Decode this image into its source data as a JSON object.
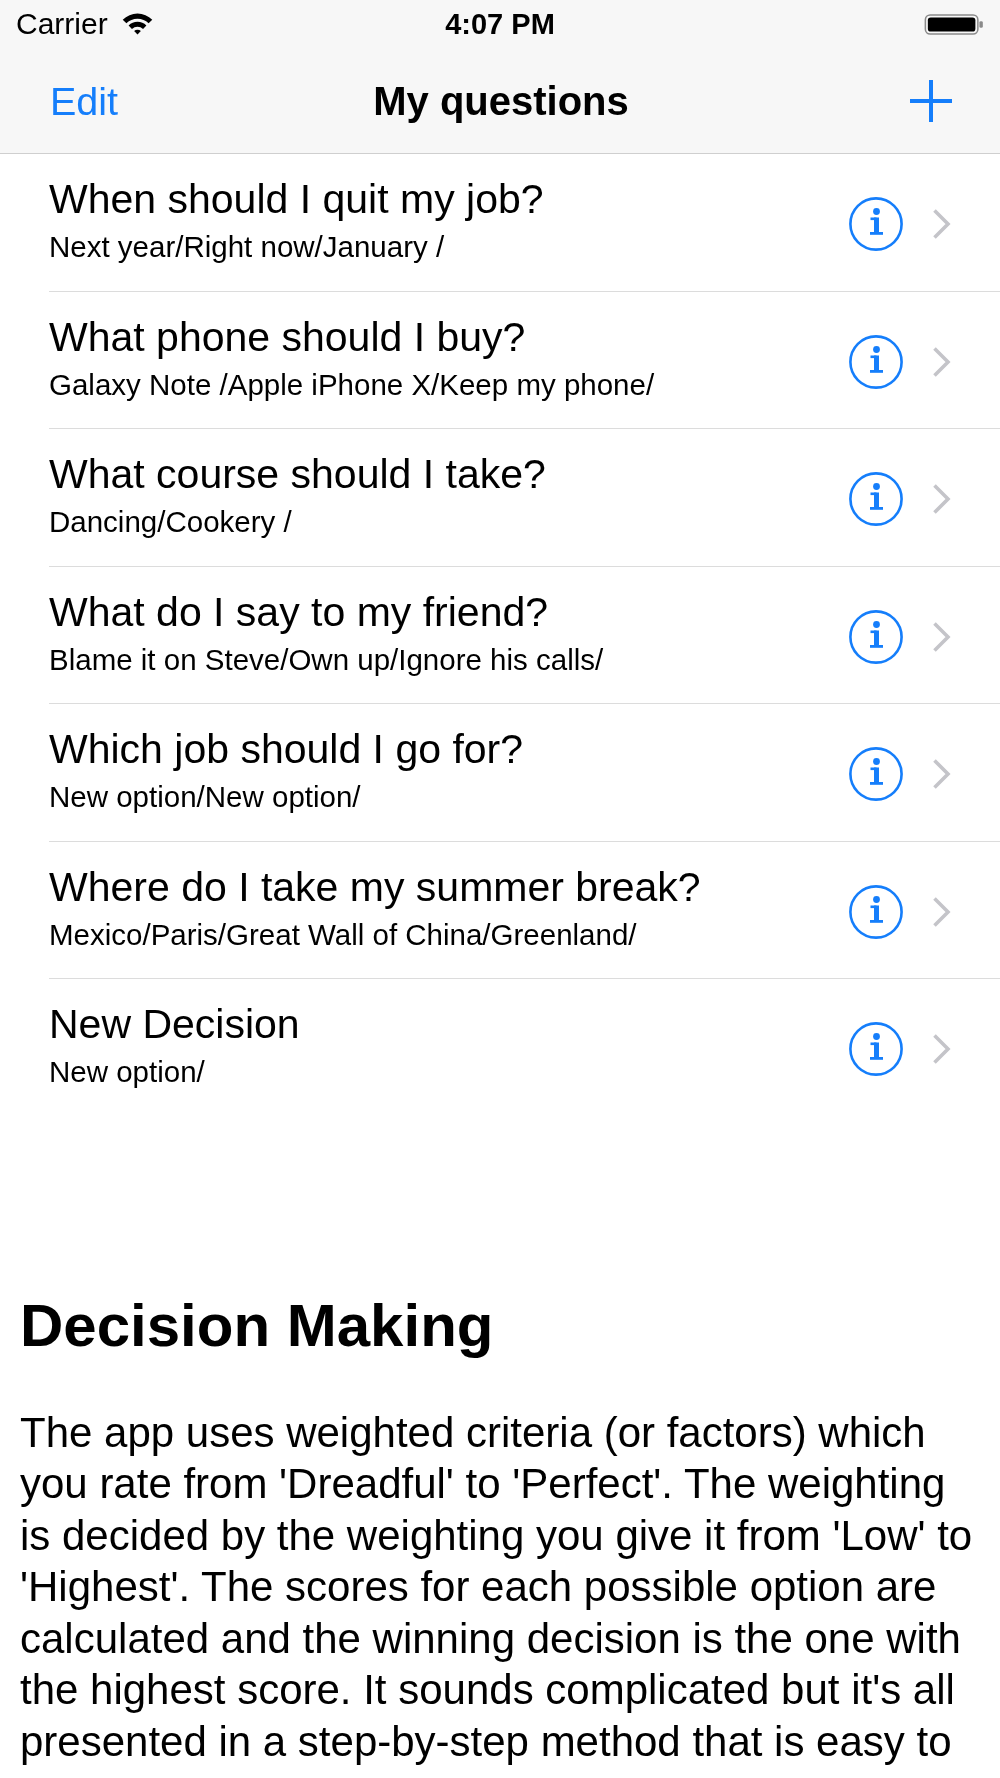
{
  "status_bar": {
    "carrier": "Carrier",
    "time": "4:07 PM"
  },
  "nav_bar": {
    "left_button": "Edit",
    "title": "My questions"
  },
  "questions": [
    {
      "title": "When should I quit my job?",
      "options": "Next year/Right now/January /"
    },
    {
      "title": "What phone should I buy?",
      "options": "Galaxy Note /Apple iPhone X/Keep my phone/"
    },
    {
      "title": "What course should I take?",
      "options": "Dancing/Cookery /"
    },
    {
      "title": "What do I say to my friend?",
      "options": "Blame it on Steve/Own up/Ignore his calls/"
    },
    {
      "title": "Which job should I go for?",
      "options": "New option/New option/"
    },
    {
      "title": "Where do I take my summer break?",
      "options": "Mexico/Paris/Great Wall of China/Greenland/"
    },
    {
      "title": "New Decision",
      "options": "New option/"
    }
  ],
  "about": {
    "heading": "Decision Making",
    "body": "The app uses weighted criteria (or factors) which you rate from 'Dreadful' to 'Perfect'. The weighting is decided by the weighting you give it from 'Low' to 'Highest'. The scores for each possible option are calculated and the winning decision is the one with the highest score. It sounds complicated but it's all presented in a step-by-step method that is easy to"
  }
}
